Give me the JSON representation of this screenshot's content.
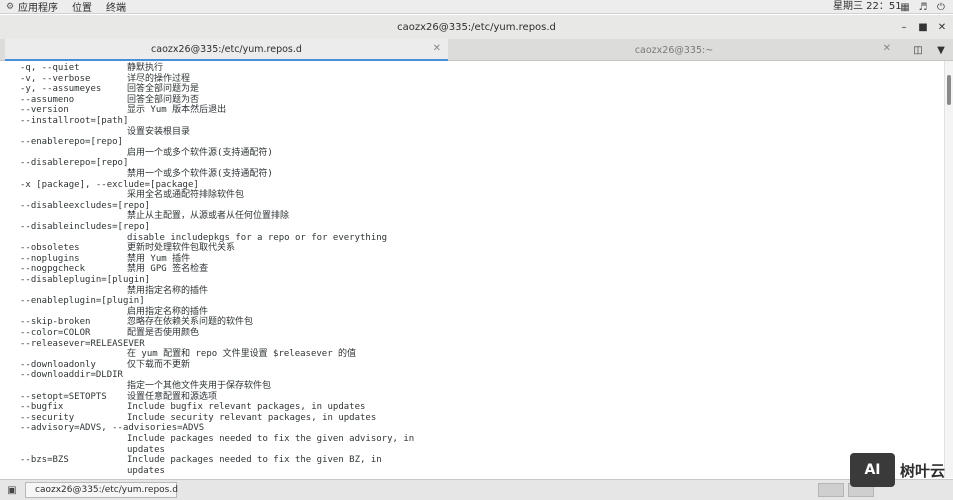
{
  "top_panel": {
    "applications": "应用程序",
    "places": "位置",
    "terminal": "终端",
    "clock": "星期三 22：51"
  },
  "window": {
    "title": "caozx26@335:/etc/yum.repos.d"
  },
  "tabs": [
    {
      "label": "caozx26@335:/etc/yum.repos.d",
      "active": true
    },
    {
      "label": "caozx26@335:~",
      "active": false
    }
  ],
  "terminal_lines": [
    {
      "opt": "-q, --quiet",
      "desc": "静默执行"
    },
    {
      "opt": "-v, --verbose",
      "desc": "详尽的操作过程"
    },
    {
      "opt": "-y, --assumeyes",
      "desc": "回答全部问题为是"
    },
    {
      "opt": "--assumeno",
      "desc": "回答全部问题为否"
    },
    {
      "opt": "--version",
      "desc": "显示 Yum 版本然后退出"
    },
    {
      "opt": "--installroot=[path]",
      "desc": ""
    },
    {
      "opt": "",
      "desc": "设置安装根目录"
    },
    {
      "opt": "--enablerepo=[repo]",
      "desc": ""
    },
    {
      "opt": "",
      "desc": "启用一个或多个软件源(支持通配符)"
    },
    {
      "opt": "--disablerepo=[repo]",
      "desc": ""
    },
    {
      "opt": "",
      "desc": "禁用一个或多个软件源(支持通配符)"
    },
    {
      "opt": "-x [package], --exclude=[package]",
      "desc": ""
    },
    {
      "opt": "",
      "desc": "采用全名或通配符排除软件包"
    },
    {
      "opt": "--disableexcludes=[repo]",
      "desc": ""
    },
    {
      "opt": "",
      "desc": "禁止从主配置，从源或者从任何位置排除"
    },
    {
      "opt": "--disableincludes=[repo]",
      "desc": ""
    },
    {
      "opt": "",
      "desc": "disable includepkgs for a repo or for everything"
    },
    {
      "opt": "--obsoletes",
      "desc": "更新时处理软件包取代关系"
    },
    {
      "opt": "--noplugins",
      "desc": "禁用 Yum 插件"
    },
    {
      "opt": "--nogpgcheck",
      "desc": "禁用 GPG 签名检查"
    },
    {
      "opt": "--disableplugin=[plugin]",
      "desc": ""
    },
    {
      "opt": "",
      "desc": "禁用指定名称的插件"
    },
    {
      "opt": "--enableplugin=[plugin]",
      "desc": ""
    },
    {
      "opt": "",
      "desc": "启用指定名称的插件"
    },
    {
      "opt": "--skip-broken",
      "desc": "忽略存在依赖关系问题的软件包"
    },
    {
      "opt": "--color=COLOR",
      "desc": "配置是否使用颜色"
    },
    {
      "opt": "--releasever=RELEASEVER",
      "desc": ""
    },
    {
      "opt": "",
      "desc": "在 yum 配置和 repo 文件里设置 $releasever 的值"
    },
    {
      "opt": "--downloadonly",
      "desc": "仅下载而不更新"
    },
    {
      "opt": "--downloaddir=DLDIR",
      "desc": ""
    },
    {
      "opt": "",
      "desc": "指定一个其他文件夹用于保存软件包"
    },
    {
      "opt": "--setopt=SETOPTS",
      "desc": "设置任意配置和源选项"
    },
    {
      "opt": "--bugfix",
      "desc": "Include bugfix relevant packages, in updates"
    },
    {
      "opt": "--security",
      "desc": "Include security relevant packages, in updates"
    },
    {
      "opt": "--advisory=ADVS, --advisories=ADVS",
      "desc": ""
    },
    {
      "opt": "",
      "desc": "Include packages needed to fix the given advisory, in"
    },
    {
      "opt": "",
      "desc": "updates"
    },
    {
      "opt": "--bzs=BZS",
      "desc": "Include packages needed to fix the given BZ, in"
    },
    {
      "opt": "",
      "desc": "updates"
    }
  ],
  "taskbar": {
    "task_label": "caozx26@335:/etc/yum.repos.d"
  },
  "watermark": {
    "logo": "AI",
    "text": "树叶云"
  }
}
